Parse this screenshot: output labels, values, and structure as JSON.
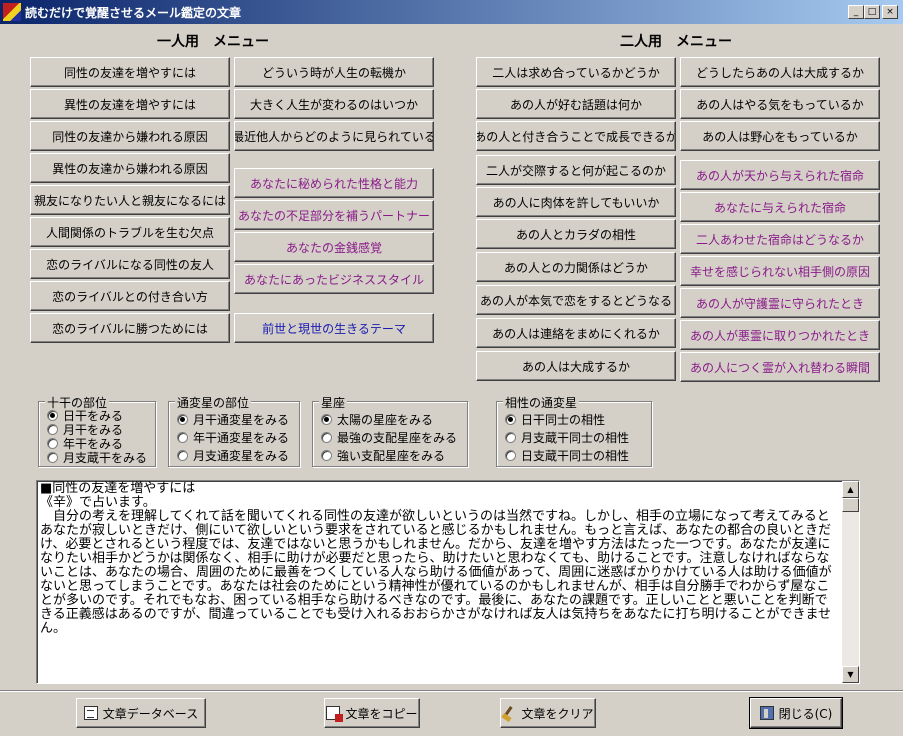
{
  "window": {
    "title": "読むだけで覚醒させるメール鑑定の文章",
    "minimize": "_",
    "maximize": "□",
    "close": "×"
  },
  "single_menu": {
    "heading": "一人用　メニュー",
    "col1": [
      "同性の友達を増やすには",
      "異性の友達を増やすには",
      "同性の友達から嫌われる原因",
      "異性の友達から嫌われる原因",
      "親友になりたい人と親友になるには",
      "人間関係のトラブルを生む欠点",
      "恋のライバルになる同性の友人",
      "恋のライバルとの付き合い方",
      "恋のライバルに勝つためには"
    ],
    "col2_top": [
      "どういう時が人生の転機か",
      "大きく人生が変わるのはいつか",
      "最近他人からどのように見られている"
    ],
    "col2_purple": [
      "あなたに秘められた性格と能力",
      "あなたの不足部分を補うパートナー",
      "あなたの金銭感覚",
      "あなたにあったビジネススタイル"
    ],
    "col2_blue": "前世と現世の生きるテーマ"
  },
  "pair_menu": {
    "heading": "二人用　メニュー",
    "col1": [
      "二人は求め合っているかどうか",
      "あの人が好む話題は何か",
      "あの人と付き合うことで成長できるか",
      "二人が交際すると何が起こるのか",
      "あの人に肉体を許してもいいか",
      "あの人とカラダの相性",
      "あの人との力関係はどうか",
      "あの人が本気で恋をするとどうなる",
      "あの人は連絡をまめにくれるか",
      "あの人は大成するか"
    ],
    "col2_top": [
      "どうしたらあの人は大成するか",
      "あの人はやる気をもっているか",
      "あの人は野心をもっているか"
    ],
    "col2_purple": [
      "あの人が天から与えられた宿命",
      "あなたに与えられた宿命",
      "二人あわせた宿命はどうなるか",
      "幸せを感じられない相手側の原因",
      "あの人が守護霊に守られたとき",
      "あの人が悪霊に取りつかれたとき",
      "あの人につく霊が入れ替わる瞬間"
    ]
  },
  "groups": {
    "jikkan": {
      "title": "十干の部位",
      "options": [
        "日干をみる",
        "月干をみる",
        "年干をみる",
        "月支蔵干をみる"
      ],
      "selected": 0
    },
    "tsuhen": {
      "title": "通変星の部位",
      "options": [
        "月干通変星をみる",
        "年干通変星をみる",
        "月支通変星をみる"
      ],
      "selected": 0
    },
    "seiza": {
      "title": "星座",
      "options": [
        "太陽の星座をみる",
        "最強の支配星座をみる",
        "強い支配星座をみる"
      ],
      "selected": 0
    },
    "aisho": {
      "title": "相性の通変星",
      "options": [
        "日干同士の相性",
        "月支蔵干同士の相性",
        "日支蔵干同士の相性"
      ],
      "selected": 0
    }
  },
  "text_output": "■同性の友達を増やすには\n《辛》で占います。\n　自分の考えを理解してくれて話を聞いてくれる同性の友達が欲しいというのは当然ですね。しかし、相手の立場になって考えてみるとあなたが寂しいときだけ、側にいて欲しいという要求をされていると感じるかもしれません。もっと言えば、あなたの都合の良いときだけ、必要とされるという程度では、友達ではないと思うかもしれません。だから、友達を増やす方法はたった一つです。あなたが友達になりたい相手かどうかは関係なく、相手に助けが必要だと思ったら、助けたいと思わなくても、助けることです。注意しなければならないことは、あなたの場合、周囲のために最善をつくしている人なら助ける価値があって、周囲に迷惑ばかりかけている人は助ける価値がないと思ってしまうことです。あなたは社会のためにという精神性が優れているのかもしれませんが、相手は自分勝手でわからず屋なことが多いのです。それでもなお、困っている相手なら助けるべきなのです。最後に、あなたの課題です。正しいことと悪いことを判断できる正義感はあるのですが、間違っていることでも受け入れるおおらかさがなければ友人は気持ちをあなたに打ち明けることができません。",
  "bottom_buttons": {
    "database": "文章データベース",
    "copy": "文章をコピー",
    "clear": "文章をクリア",
    "close": "閉じる(C)"
  }
}
